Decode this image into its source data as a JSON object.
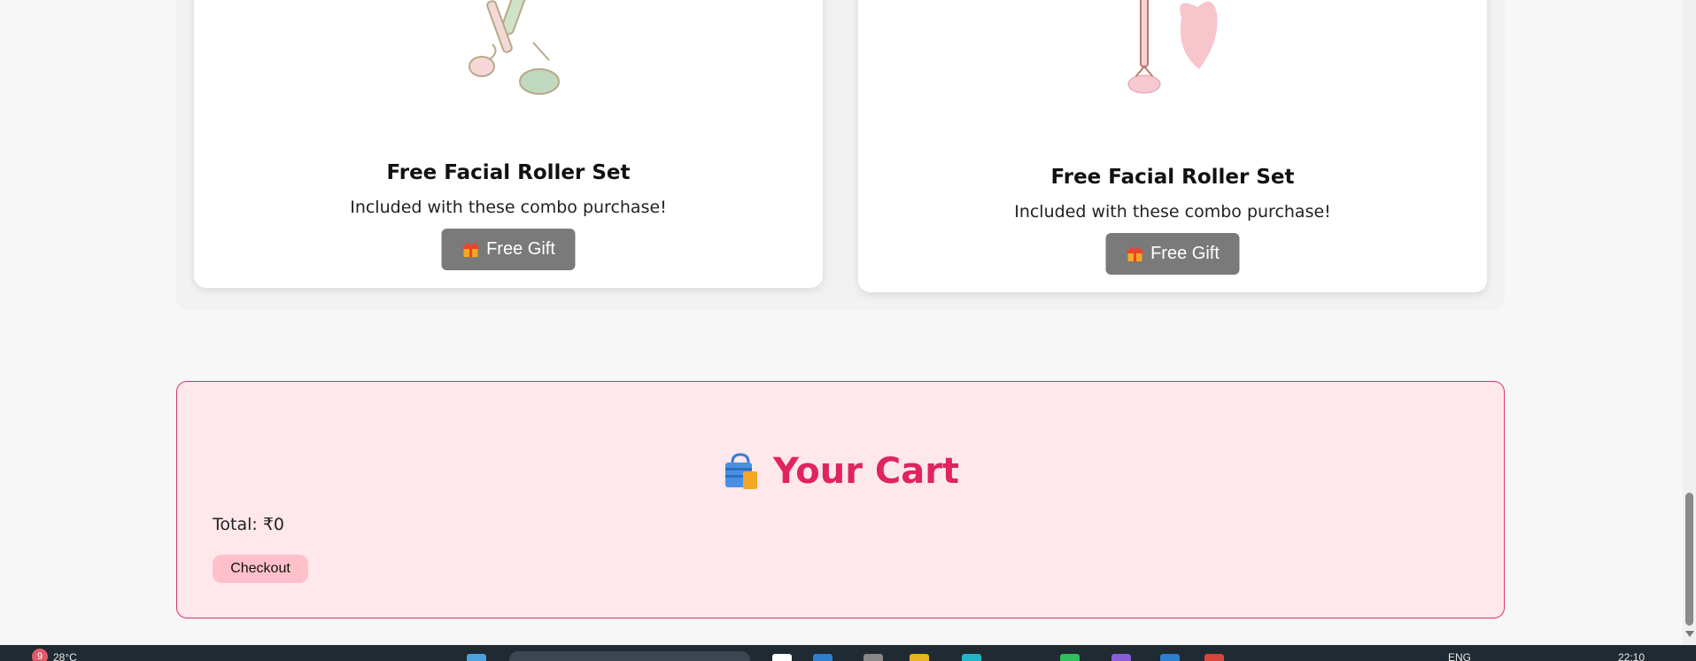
{
  "products": [
    {
      "title": "Free Facial Roller Set",
      "subtitle": "Included with these combo purchase!",
      "button_label": "Free Gift"
    },
    {
      "title": "Free Facial Roller Set",
      "subtitle": "Included with these combo purchase!",
      "button_label": "Free Gift"
    }
  ],
  "cart": {
    "heading": "Your Cart",
    "total": "Total: ₹0",
    "checkout_label": "Checkout"
  },
  "taskbar": {
    "weather_badge": "9",
    "temperature": "28°C",
    "language": "ENG",
    "time": "22:10"
  },
  "colors": {
    "accent": "#e0245e",
    "cart_background": "#ffe8ec",
    "cart_border": "#d6336c",
    "checkout_button": "#ffc0cb",
    "gift_button": "#7a7a7a"
  },
  "icons": [
    "gift-icon",
    "shopping-bag-icon",
    "facial-roller-image",
    "gua-sha-roller-image"
  ]
}
